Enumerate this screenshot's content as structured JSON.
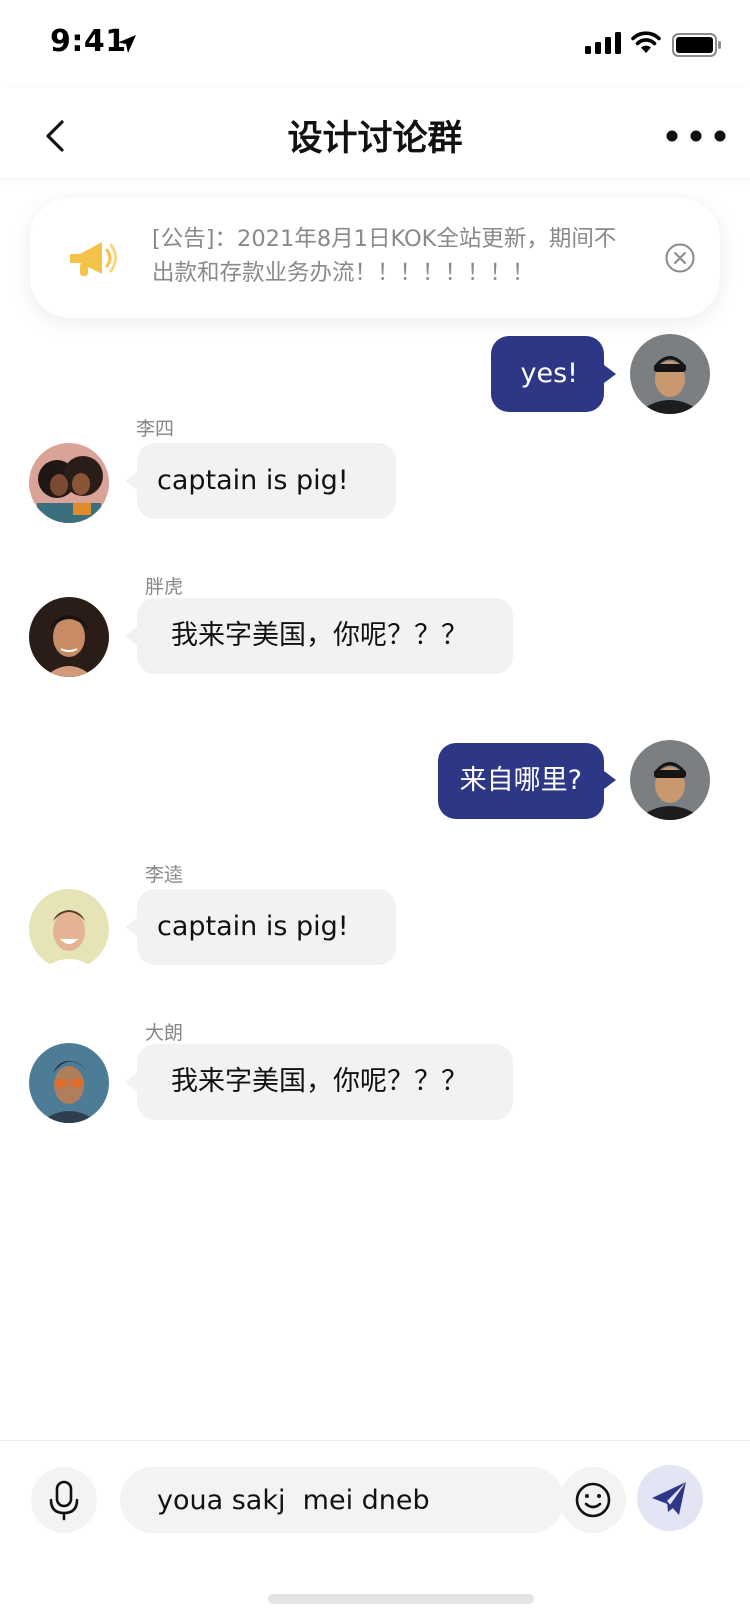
{
  "status_bar": {
    "time": "9:41"
  },
  "nav": {
    "title": "设计讨论群"
  },
  "announcement": {
    "text": "[公告]：2021年8月1日KOK全站更新，期间不出款和存款业务办流！！！！！！！！"
  },
  "messages": [
    {
      "direction": "out",
      "text": "yes!"
    },
    {
      "direction": "in",
      "sender": "李四",
      "text": "captain is pig!"
    },
    {
      "direction": "in",
      "sender": "胖虎",
      "text": "我来字美国，你呢？？？"
    },
    {
      "direction": "out",
      "text": "来自哪里?"
    },
    {
      "direction": "in",
      "sender": "李逵",
      "text": "captain is pig!"
    },
    {
      "direction": "in",
      "sender": "大朗",
      "text": "我来字美国，你呢？？？"
    }
  ],
  "composer": {
    "value": "youa sakj  mei dneb"
  },
  "colors": {
    "outgoing_bubble": "#2d3785",
    "incoming_bubble": "#f2f2f2",
    "announce_icon": "#f6c34a",
    "send_icon": "#2d3785"
  },
  "icons": {
    "back": "chevron-left-icon",
    "more": "more-dots-icon",
    "announce": "megaphone-icon",
    "close": "close-circle-icon",
    "mic": "microphone-icon",
    "emoji": "smiley-icon",
    "send": "paper-plane-icon"
  }
}
